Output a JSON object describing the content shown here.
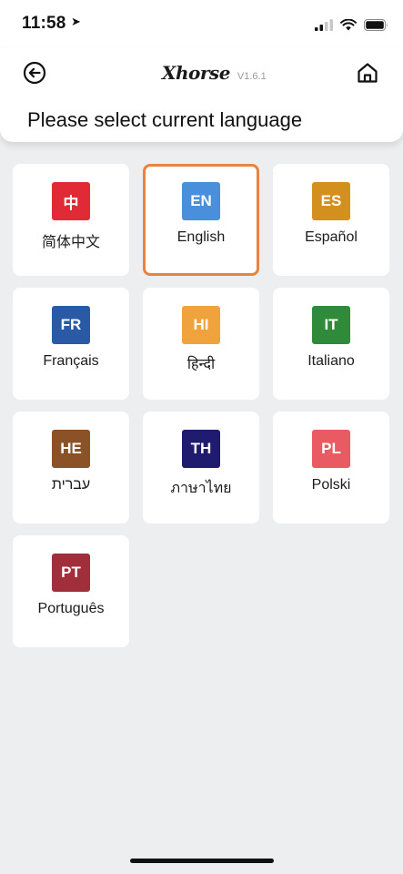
{
  "status_bar": {
    "time": "11:58",
    "location_arrow": "➤",
    "icons": [
      "cellular-signal-icon",
      "wifi-icon",
      "battery-icon"
    ]
  },
  "header": {
    "brand": "Xhorse",
    "version": "V1.6.1",
    "title": "Please select current language",
    "back_icon": "back-arrow-icon",
    "home_icon": "home-icon"
  },
  "languages": [
    {
      "code": "中",
      "label": "简体中文",
      "color": "#e02b36",
      "selected": false
    },
    {
      "code": "EN",
      "label": "English",
      "color": "#4a8fdc",
      "selected": true
    },
    {
      "code": "ES",
      "label": "Español",
      "color": "#d4901f",
      "selected": false
    },
    {
      "code": "FR",
      "label": "Français",
      "color": "#2a5aa6",
      "selected": false
    },
    {
      "code": "HI",
      "label": "हिन्दी",
      "color": "#f0a33c",
      "selected": false
    },
    {
      "code": "IT",
      "label": "Italiano",
      "color": "#2f8a3a",
      "selected": false
    },
    {
      "code": "HE",
      "label": "עברית",
      "color": "#8a5226",
      "selected": false
    },
    {
      "code": "TH",
      "label": "ภาษาไทย",
      "color": "#1f1b6e",
      "selected": false
    },
    {
      "code": "PL",
      "label": "Polski",
      "color": "#ea5a62",
      "selected": false
    },
    {
      "code": "PT",
      "label": "Português",
      "color": "#a12f3b",
      "selected": false
    }
  ],
  "colors": {
    "selected_border": "#e8843c",
    "background": "#edeef0"
  }
}
